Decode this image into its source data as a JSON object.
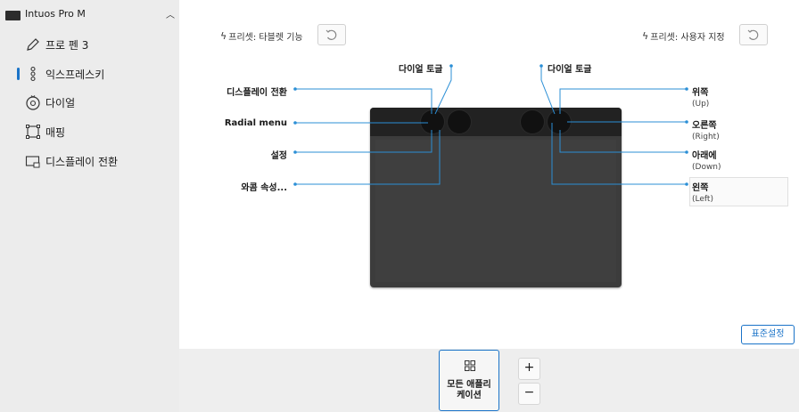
{
  "sidebar": {
    "device_name": "Intuos Pro M",
    "items": [
      {
        "label": "프로 펜 3",
        "icon": "pen-icon"
      },
      {
        "label": "익스프레스키",
        "icon": "expresskeys-icon",
        "selected": true
      },
      {
        "label": "다이얼",
        "icon": "dial-icon"
      },
      {
        "label": "매핑",
        "icon": "mapping-icon"
      },
      {
        "label": "디스플레이 전환",
        "icon": "display-toggle-icon"
      }
    ]
  },
  "presets": {
    "left": "프리셋: 타블렛 기능",
    "right": "프리셋: 사용자 지정"
  },
  "labels_left": {
    "dial_toggle": "다이얼 토글",
    "display_toggle": "디스플레이 전환",
    "radial_menu": "Radial menu",
    "settings": "설정",
    "modifiers": "와콤 속성..."
  },
  "labels_right": {
    "dial_toggle": "다이얼 토글",
    "up": "위쪽",
    "up_sub": "(Up)",
    "right": "오른쪽",
    "right_sub": "(Right)",
    "down": "아래에",
    "down_sub": "(Down)",
    "left": "왼쪽",
    "left_sub": "(Left)"
  },
  "buttons": {
    "reset": "표준설정",
    "all_apps_line1": "모든 애플리",
    "all_apps_line2": "케이션",
    "plus": "+",
    "minus": "−"
  },
  "colors": {
    "accent": "#1a73c8",
    "callout": "#2b8fd6"
  }
}
